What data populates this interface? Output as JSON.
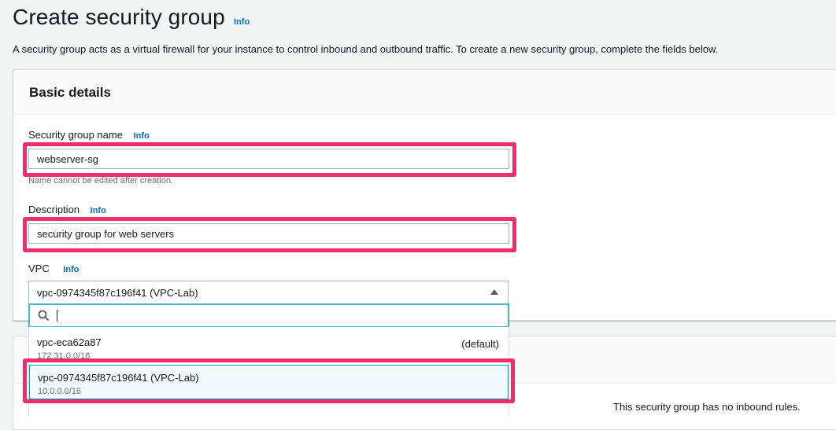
{
  "page": {
    "title": "Create security group",
    "title_info": "Info",
    "intro": "A security group acts as a virtual firewall for your instance to control inbound and outbound traffic. To create a new security group, complete the fields below."
  },
  "basic_details": {
    "heading": "Basic details",
    "sg_name": {
      "label": "Security group name",
      "info": "Info",
      "value": "webserver-sg",
      "hint": "Name cannot be edited after creation."
    },
    "description": {
      "label": "Description",
      "info": "Info",
      "value": "security group for web servers"
    },
    "vpc": {
      "label": "VPC",
      "info": "Info",
      "selected": "vpc-0974345f87c196f41 (VPC-Lab)",
      "search_value": "",
      "options": [
        {
          "name": "vpc-eca62a87",
          "cidr": "172.31.0.0/16",
          "tag": "(default)"
        },
        {
          "name": "vpc-0974345f87c196f41 (VPC-Lab)",
          "cidr": "10.0.0.0/16",
          "tag": ""
        }
      ]
    }
  },
  "inbound": {
    "empty_text": "This security group has no inbound rules."
  },
  "colors": {
    "highlight": "#ec2f6b",
    "link": "#0073bb",
    "focus": "#44b9d6"
  }
}
